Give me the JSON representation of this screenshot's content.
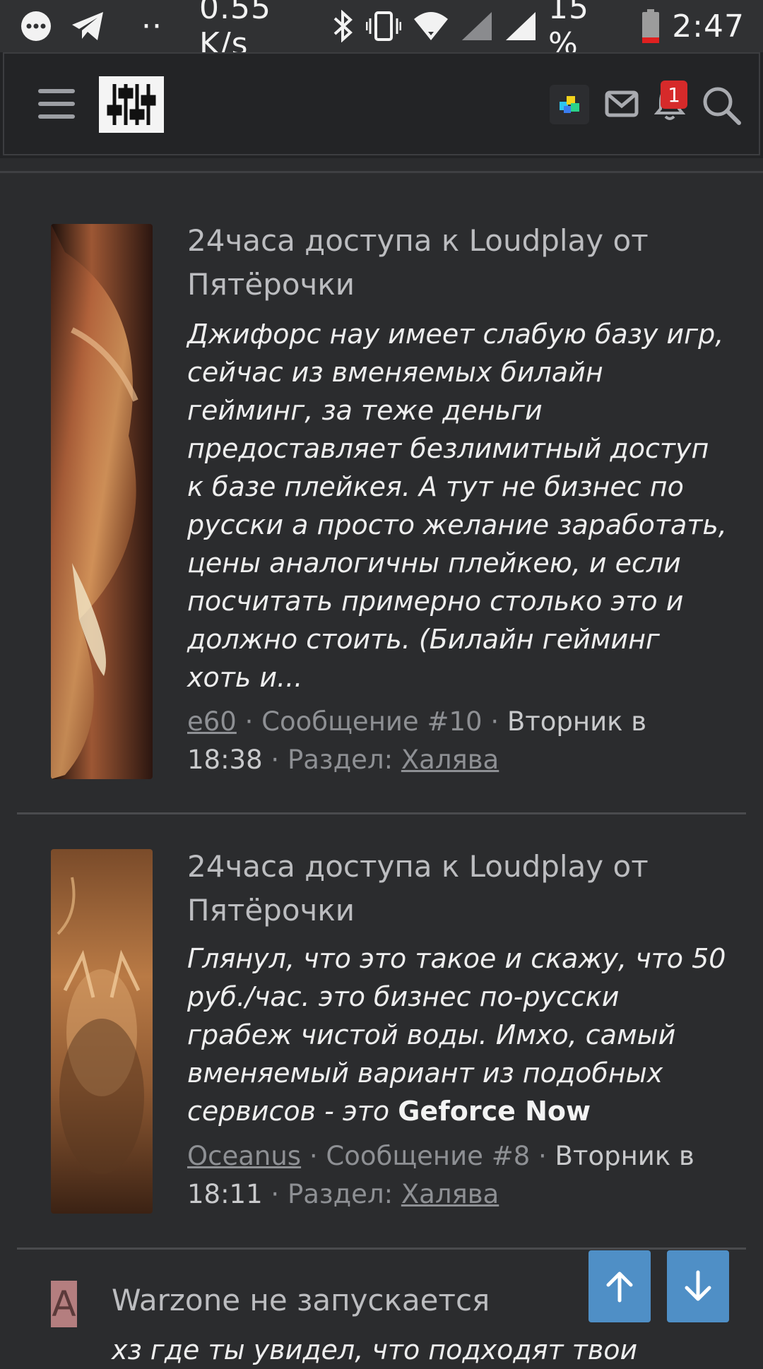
{
  "status_bar": {
    "net_speed": "0.55 K/s",
    "battery": "15 %",
    "time": "2:47",
    "dots": "··",
    "icons": [
      "chat-bubble-icon",
      "telegram-icon",
      "bluetooth-icon",
      "vibrate-icon",
      "wifi-icon",
      "signal-icon",
      "battery-icon"
    ]
  },
  "header": {
    "notification_count": "1",
    "icons": [
      "menu-icon",
      "site-logo",
      "colorful-squares-icon",
      "mail-icon",
      "bell-icon",
      "search-icon"
    ]
  },
  "posts": [
    {
      "title": "24часа доступа к Loudplay от Пятёрочки",
      "body": "Джифорс нау имеет слабую базу игр, сейчас из вменяемых билайн гейминг, за теже деньги предоставляет безлимитный доступ к базе плейкея. А тут не бизнес по русски а просто желание заработать, цены аналогичны плейкею, и если посчитать примерно столько это и должно стоить. (Билайн гейминг хоть и...",
      "author": "e60",
      "message": "Сообщение #10",
      "date": "Вторник в 18:38",
      "section_label": "Раздел:",
      "section": "Халява"
    },
    {
      "title": "24часа доступа к Loudplay от Пятёрочки",
      "body": "Глянул, что это такое и скажу, что 50 руб./час. это бизнес по-русски грабеж чистой воды. Имхо, самый вменяемый вариант из подобных сервисов - это",
      "body_bold": "Geforce Now",
      "author": "Oceanus",
      "message": "Сообщение #8",
      "date": "Вторник в 18:11",
      "section_label": "Раздел:",
      "section": "Халява"
    },
    {
      "avatar_letter": "A",
      "title": "Warzone не запускается",
      "body": "хз где ты увидел, что подходят твои"
    }
  ],
  "colors": {
    "background": "#2b2c2e",
    "header": "#232426",
    "accent_button": "#4f8fc6",
    "badge": "#d62a2a"
  }
}
